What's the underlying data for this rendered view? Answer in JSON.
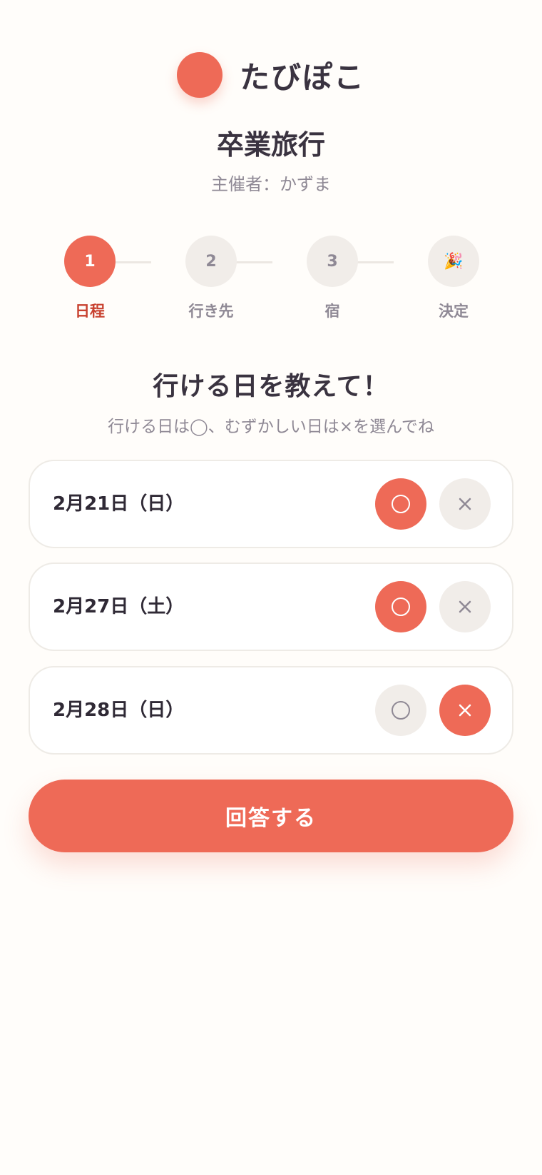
{
  "app": {
    "brand": "たびぽこ",
    "accent_color": "#ee6a57"
  },
  "event": {
    "title": "卒業旅行",
    "organizer": "主催者：かずま"
  },
  "steps": [
    {
      "number": "1",
      "label": "日程",
      "active": true
    },
    {
      "number": "2",
      "label": "行き先",
      "active": false
    },
    {
      "number": "3",
      "label": "宿",
      "active": false
    },
    {
      "number": "🎉",
      "label": "決定",
      "active": false
    }
  ],
  "question": {
    "title": "行ける日を教えて！",
    "instruction": "行ける日は◯、むずかしい日は×を選んでね"
  },
  "dates": [
    {
      "label": "2月21日（日）",
      "selection": "yes"
    },
    {
      "label": "2月27日（土）",
      "selection": "yes"
    },
    {
      "label": "2月28日（日）",
      "selection": "no"
    }
  ],
  "icons": {
    "yes": "circle-icon",
    "no": "cross-icon"
  },
  "submit": {
    "label": "回答する"
  }
}
